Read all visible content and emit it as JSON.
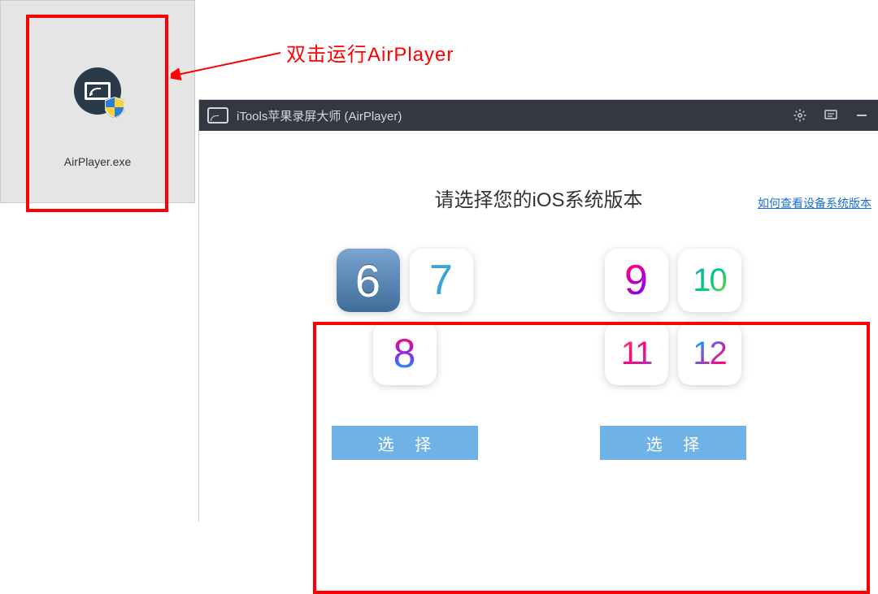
{
  "desktop": {
    "icon_label": "AirPlayer.exe"
  },
  "annotation": {
    "text": "双击运行AirPlayer"
  },
  "window": {
    "title": "iTools苹果录屏大师 (AirPlayer)"
  },
  "body": {
    "help_link": "如何查看设备系统版本",
    "prompt": "请选择您的iOS系统版本"
  },
  "groups": {
    "left": {
      "versions": [
        {
          "label": "6",
          "cls": "v6"
        },
        {
          "label": "7",
          "cls": "v7"
        },
        {
          "label": "8",
          "cls": "v8 grad8"
        }
      ],
      "button": "选 择"
    },
    "right": {
      "versions": [
        {
          "label": "9",
          "cls": "grad9"
        },
        {
          "label": "10",
          "cls": "ten grad10"
        },
        {
          "label": "11",
          "cls": "eleven grad11"
        },
        {
          "label": "12",
          "cls": "twelve grad12"
        }
      ],
      "button": "选 择"
    }
  }
}
